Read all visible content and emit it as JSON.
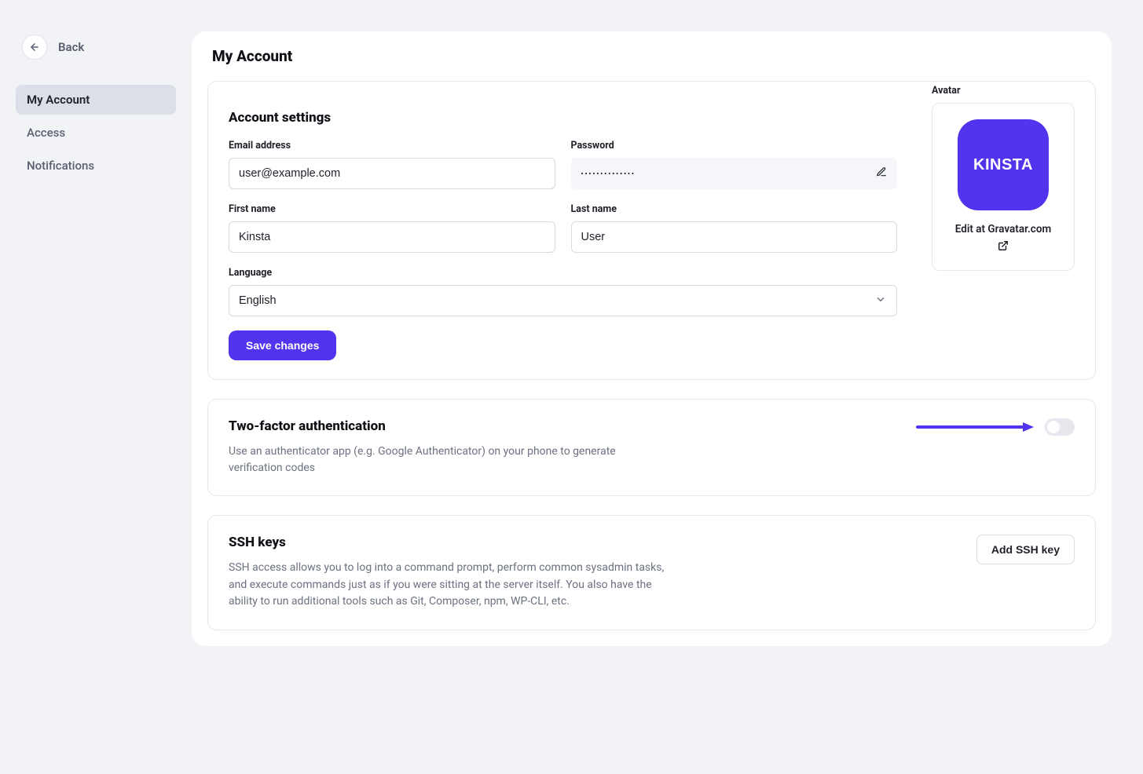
{
  "sidebar": {
    "back_label": "Back",
    "items": [
      {
        "label": "My Account",
        "active": true
      },
      {
        "label": "Access",
        "active": false
      },
      {
        "label": "Notifications",
        "active": false
      }
    ]
  },
  "page": {
    "title": "My Account"
  },
  "account": {
    "section_title": "Account settings",
    "email_label": "Email address",
    "email_value": "user@example.com",
    "password_label": "Password",
    "password_masked": "••••••••••••••",
    "first_name_label": "First name",
    "first_name_value": "Kinsta",
    "last_name_label": "Last name",
    "last_name_value": "User",
    "language_label": "Language",
    "language_value": "English",
    "save_button": "Save changes",
    "avatar_label": "Avatar",
    "avatar_text": "KINSTA",
    "gravatar_link": "Edit at Gravatar.com"
  },
  "twofa": {
    "title": "Two-factor authentication",
    "description": "Use an authenticator app (e.g. Google Authenticator) on your phone to generate verification codes",
    "enabled": false
  },
  "ssh": {
    "title": "SSH keys",
    "add_button": "Add SSH key",
    "description": "SSH access allows you to log into a command prompt, perform common sysadmin tasks, and execute commands just as if you were sitting at the server itself. You also have the ability to run additional tools such as Git, Composer, npm, WP-CLI, etc."
  },
  "colors": {
    "accent": "#5333ed"
  }
}
